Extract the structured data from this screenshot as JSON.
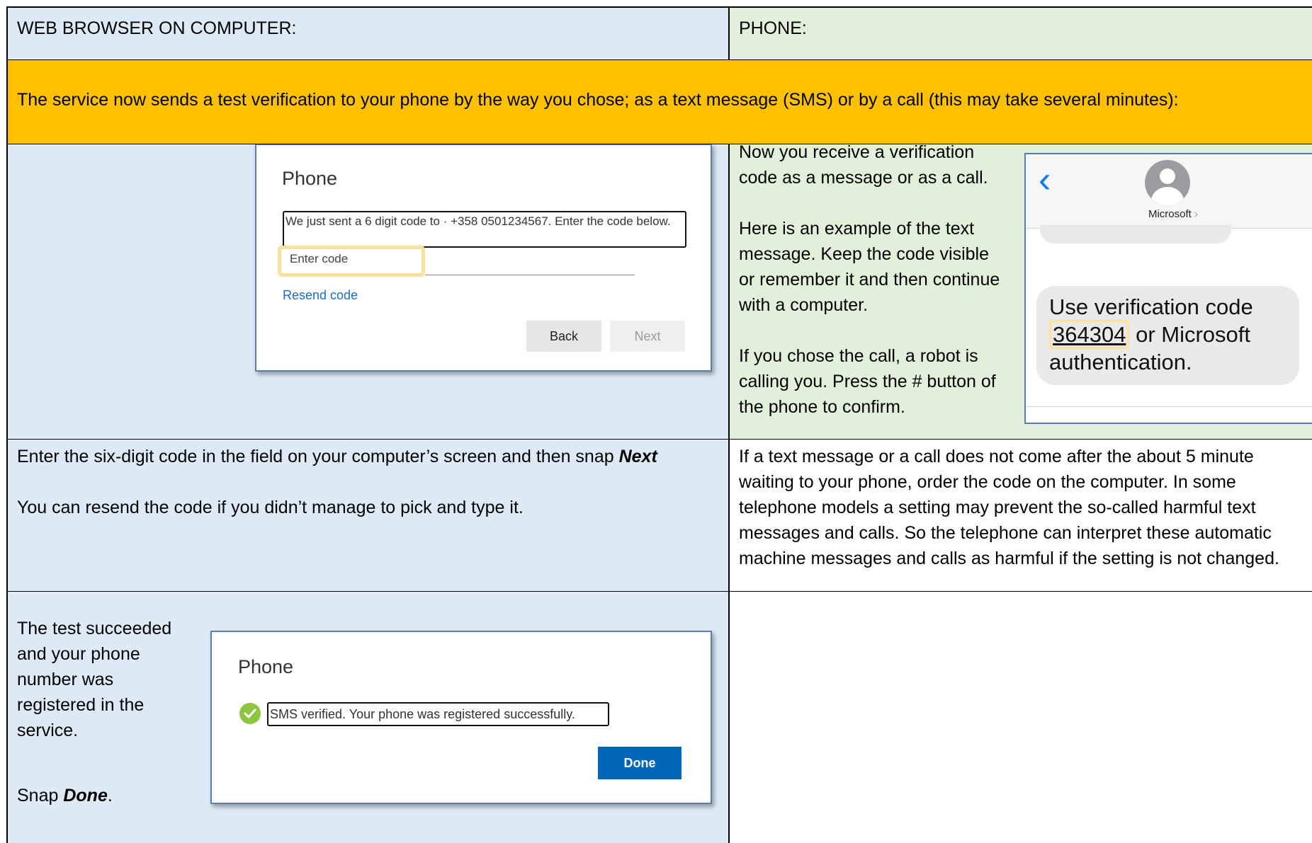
{
  "header": {
    "computer_label": "WEB BROWSER ON COMPUTER:",
    "phone_label": "PHONE:"
  },
  "banner": {
    "text": "The service now sends a test verification to your phone by the way you chose; as a text message (SMS) or by a call (this may take several minutes):"
  },
  "dialog1": {
    "title": "Phone",
    "message": "We just sent a 6 digit code to · +358 0501234567. Enter the code below.",
    "code_placeholder": "Enter code",
    "resend_link": "Resend code",
    "back_label": "Back",
    "next_label": "Next"
  },
  "phone_instructions": {
    "p1": "Now you receive a verification code as a message or as a call.",
    "p2": "Here is an example of the text message. Keep the code visible or remember it and then continue with a computer.",
    "p3": "If you chose the call, a robot is calling you. Press the # button of the phone to confirm."
  },
  "sms": {
    "sender": "Microsoft",
    "sender_chevron": "›",
    "back_chevron": "‹",
    "text_before": "Use verification code",
    "code": "364304",
    "text_after": "or Microsoft authentication."
  },
  "step2": {
    "line1_prefix": "Enter the six-digit code in the field on your computer’s screen and then snap ",
    "line1_bold": "Next",
    "line2": "You can resend the code if you didn’t manage to pick and type it."
  },
  "phone_tip": {
    "text": "If a text message or a call does not come after the about 5 minute waiting to your phone, order the code on the computer. In some telephone models a setting may prevent the so-called harmful text messages and calls. So the telephone can interpret these automatic machine messages and calls as harmful if the setting is not changed."
  },
  "step3": {
    "text": "The test succeeded and your phone number was registered in the service.",
    "snap_prefix": "Snap ",
    "snap_bold": "Done",
    "snap_suffix": "."
  },
  "dialog2": {
    "title": "Phone",
    "message": "SMS verified. Your phone was registered successfully.",
    "done_label": "Done"
  },
  "colors": {
    "computer_column": "#dde9f5",
    "phone_column": "#e2efda",
    "banner": "#ffc000",
    "highlight": "#ffe199",
    "done_button": "#0067b8",
    "link": "#1a6fc1"
  }
}
